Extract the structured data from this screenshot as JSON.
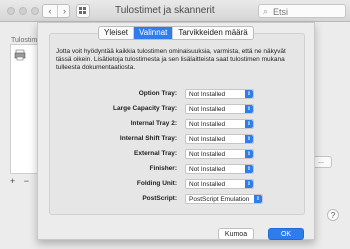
{
  "window": {
    "title": "Tulostimet ja skannerit",
    "search_placeholder": "Etsi",
    "left_label": "Tulostim",
    "right_button_label": "...",
    "help_label": "?",
    "plus_label": "+",
    "minus_label": "−"
  },
  "sheet": {
    "tabs": [
      "Yleiset",
      "Valinnat",
      "Tarvikkeiden määrä"
    ],
    "active_tab": "Valinnat",
    "info_text": "Jotta voit hyödyntää kaikkia tulostimen ominaisuuksia, varmista, että ne näkyvät tässä oikein. Lisätietoja tulostimesta ja sen lisälaitteista saat tulostimen mukana tulleesta dokumentaatiosta.",
    "options": [
      {
        "label": "Option Tray:",
        "value": "Not Installed"
      },
      {
        "label": "Large Capacity Tray:",
        "value": "Not Installed"
      },
      {
        "label": "Internal Tray 2:",
        "value": "Not Installed"
      },
      {
        "label": "Internal Shift Tray:",
        "value": "Not Installed"
      },
      {
        "label": "External Tray:",
        "value": "Not Installed"
      },
      {
        "label": "Finisher:",
        "value": "Not Installed"
      },
      {
        "label": "Folding Unit:",
        "value": "Not Installed"
      },
      {
        "label": "PostScript:",
        "value": "PostScript Emulation"
      }
    ],
    "cancel_label": "Kumoa",
    "ok_label": "OK"
  },
  "colors": {
    "accent": "#2f7dea"
  }
}
